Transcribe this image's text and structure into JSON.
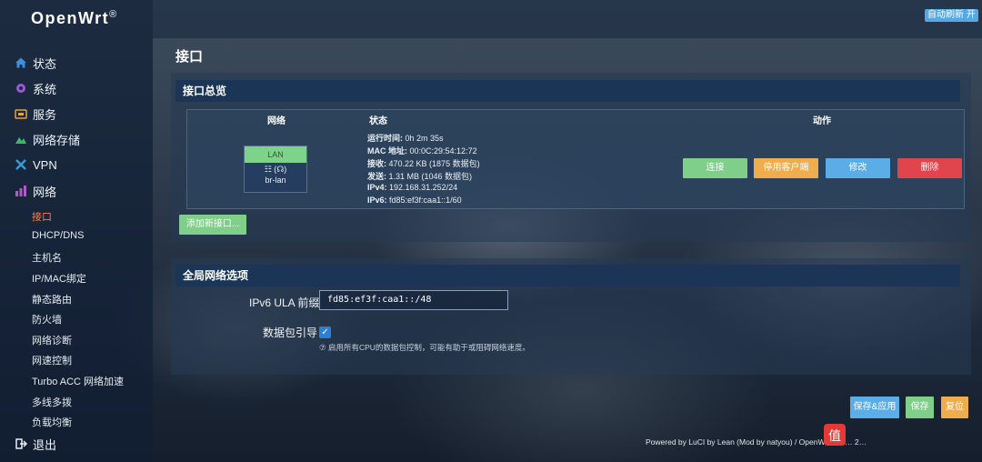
{
  "brand": {
    "name": "OpenWrt",
    "mark": "®"
  },
  "topbar": {
    "auto_refresh": "自动刷新 开"
  },
  "sidebar": {
    "menu": [
      {
        "label": "状态",
        "icon": "home-icon",
        "color": "#3e8ed8"
      },
      {
        "label": "系统",
        "icon": "gear-icon",
        "color": "#9b59d0"
      },
      {
        "label": "服务",
        "icon": "briefcase-icon",
        "color": "#e8a33c"
      },
      {
        "label": "网络存储",
        "icon": "storage-icon",
        "color": "#3fb76a"
      },
      {
        "label": "VPN",
        "icon": "vpn-icon",
        "color": "#3a9ad9"
      },
      {
        "label": "网络",
        "icon": "network-icon",
        "color": "#b05ac8"
      }
    ],
    "submenu": [
      "接口",
      "DHCP/DNS",
      "主机名",
      "IP/MAC绑定",
      "静态路由",
      "防火墙",
      "网络诊断",
      "网速控制",
      "Turbo ACC 网络加速",
      "多线多拨",
      "负载均衡"
    ],
    "active_submenu": "接口",
    "logout": "退出"
  },
  "page": {
    "title": "接口"
  },
  "overview": {
    "heading": "接口总览",
    "columns": {
      "network": "网络",
      "status": "状态",
      "actions": "动作"
    },
    "interface": {
      "name": "LAN",
      "device": "br-lan",
      "ports_glyph": "☷ (☊)",
      "status": [
        {
          "key": "运行时间:",
          "value": "0h 2m 35s"
        },
        {
          "key": "MAC 地址:",
          "value": "00:0C:29:54:12:72"
        },
        {
          "key": "接收:",
          "value": "470.22 KB (1875 数据包)"
        },
        {
          "key": "发送:",
          "value": "1.31 MB (1046 数据包)"
        },
        {
          "key": "IPv4:",
          "value": "192.168.31.252/24"
        },
        {
          "key": "IPv6:",
          "value": "fd85:ef3f:caa1::1/60"
        }
      ],
      "actions": [
        {
          "label": "连接",
          "color": "#7fce8a"
        },
        {
          "label": "停用客户端",
          "color": "#f0ad4e"
        },
        {
          "label": "修改",
          "color": "#5bade8"
        },
        {
          "label": "删除",
          "color": "#e0454e"
        }
      ]
    },
    "add_button": "添加新接口..."
  },
  "global": {
    "heading": "全局网络选项",
    "ula_label": "IPv6 ULA 前缀",
    "ula_value": "fd85:ef3f:caa1::/48",
    "pkt_label": "数据包引导",
    "pkt_checked": true,
    "hint": "⑦ 启用所有CPU的数据包控制，可能有助于或阻碍网络速度。"
  },
  "bottom_buttons": [
    {
      "label": "保存&应用",
      "color": "#5bade8"
    },
    {
      "label": "保存",
      "color": "#7fce8a"
    },
    {
      "label": "复位",
      "color": "#f0ad4e"
    }
  ],
  "footer": "Powered by LuCI by Lean (Mod by natyou) / OpenWrt 201… 2…"
}
